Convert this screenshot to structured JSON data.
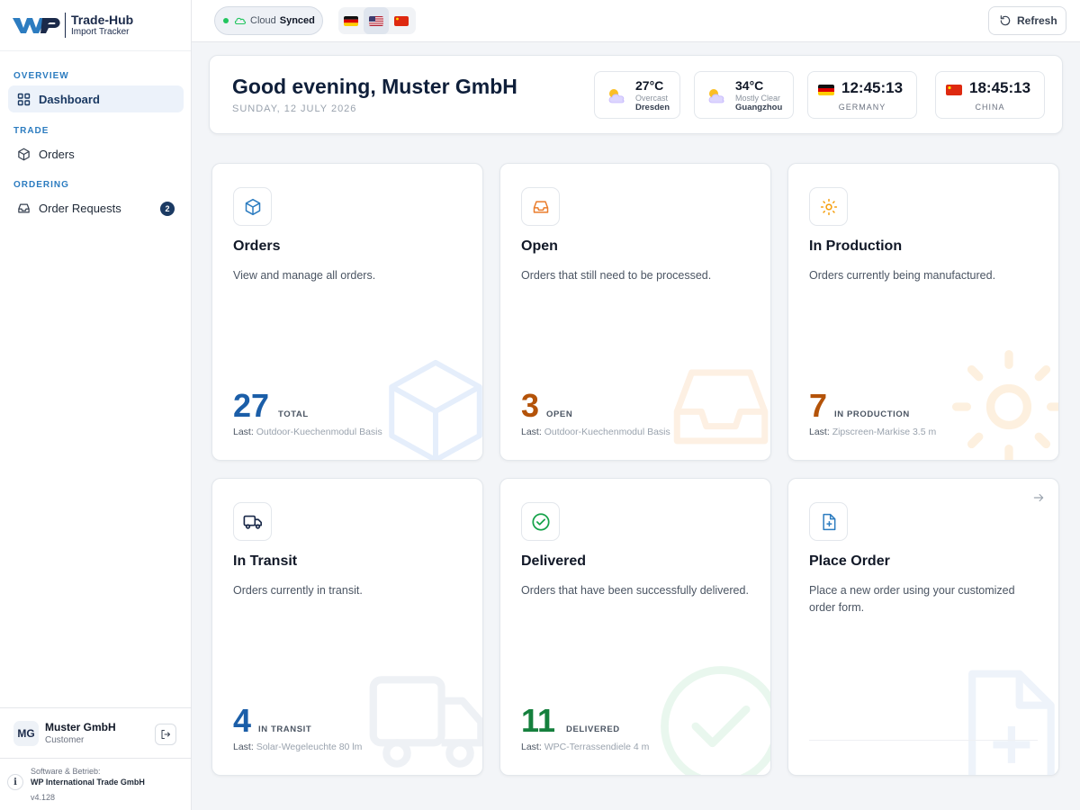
{
  "brand": {
    "title": "Trade-Hub",
    "subtitle": "Import Tracker",
    "logo_text": "WP"
  },
  "sidebar": {
    "sections": [
      {
        "label": "OVERVIEW",
        "items": [
          {
            "label": "Dashboard",
            "icon": "dashboard-grid-icon",
            "active": true
          }
        ]
      },
      {
        "label": "TRADE",
        "items": [
          {
            "label": "Orders",
            "icon": "box-icon"
          }
        ]
      },
      {
        "label": "ORDERING",
        "items": [
          {
            "label": "Order Requests",
            "icon": "inbox-icon",
            "badge": "2"
          }
        ]
      }
    ],
    "user": {
      "initials": "MG",
      "name": "Muster GmbH",
      "role": "Customer"
    },
    "credits": {
      "line1": "Software & Betrieb:",
      "line2": "WP International Trade GmbH",
      "version": "v4.128"
    }
  },
  "topbar": {
    "cloud_label": "Cloud",
    "cloud_status": "Synced",
    "languages": [
      {
        "code": "de",
        "icon": "flag-germany-icon"
      },
      {
        "code": "en",
        "icon": "flag-usa-icon",
        "active": true
      },
      {
        "code": "zh",
        "icon": "flag-china-icon"
      }
    ],
    "refresh_label": "Refresh"
  },
  "greeting": {
    "title": "Good evening, Muster GmbH",
    "date": "SUNDAY, 12 JULY 2026",
    "weather": [
      {
        "temp": "27°C",
        "condition": "Overcast",
        "city": "Dresden"
      },
      {
        "temp": "34°C",
        "condition": "Mostly Clear",
        "city": "Guangzhou"
      }
    ],
    "clocks": [
      {
        "time": "12:45:13",
        "country": "GERMANY"
      },
      {
        "time": "18:45:13",
        "country": "CHINA"
      }
    ]
  },
  "cards": [
    {
      "title": "Orders",
      "desc": "View and manage all orders.",
      "count": "27",
      "count_label": "TOTAL",
      "last_label": "Last:",
      "last_value": "Outdoor-Kuechenmodul Basis",
      "color": "#1b5ea8",
      "icon": "box-icon"
    },
    {
      "title": "Open",
      "desc": "Orders that still need to be processed.",
      "count": "3",
      "count_label": "OPEN",
      "last_label": "Last:",
      "last_value": "Outdoor-Kuechenmodul Basis",
      "color": "#b45309",
      "icon": "inbox-icon"
    },
    {
      "title": "In Production",
      "desc": "Orders currently being manufactured.",
      "count": "7",
      "count_label": "IN PRODUCTION",
      "last_label": "Last:",
      "last_value": "Zipscreen-Markise 3.5 m",
      "color": "#b45309",
      "icon": "sun-gear-icon"
    },
    {
      "title": "In Transit",
      "desc": "Orders currently in transit.",
      "count": "4",
      "count_label": "IN TRANSIT",
      "last_label": "Last:",
      "last_value": "Solar-Wegeleuchte 80 lm",
      "color": "#1b5ea8",
      "icon": "truck-icon"
    },
    {
      "title": "Delivered",
      "desc": "Orders that have been successfully delivered.",
      "count": "11",
      "count_label": "DELIVERED",
      "last_label": "Last:",
      "last_value": "WPC-Terrassendiele 4 m",
      "color": "#15803d",
      "icon": "check-circle-icon"
    },
    {
      "title": "Place Order",
      "desc": "Place a new order using your customized order form.",
      "icon": "file-plus-icon"
    }
  ]
}
